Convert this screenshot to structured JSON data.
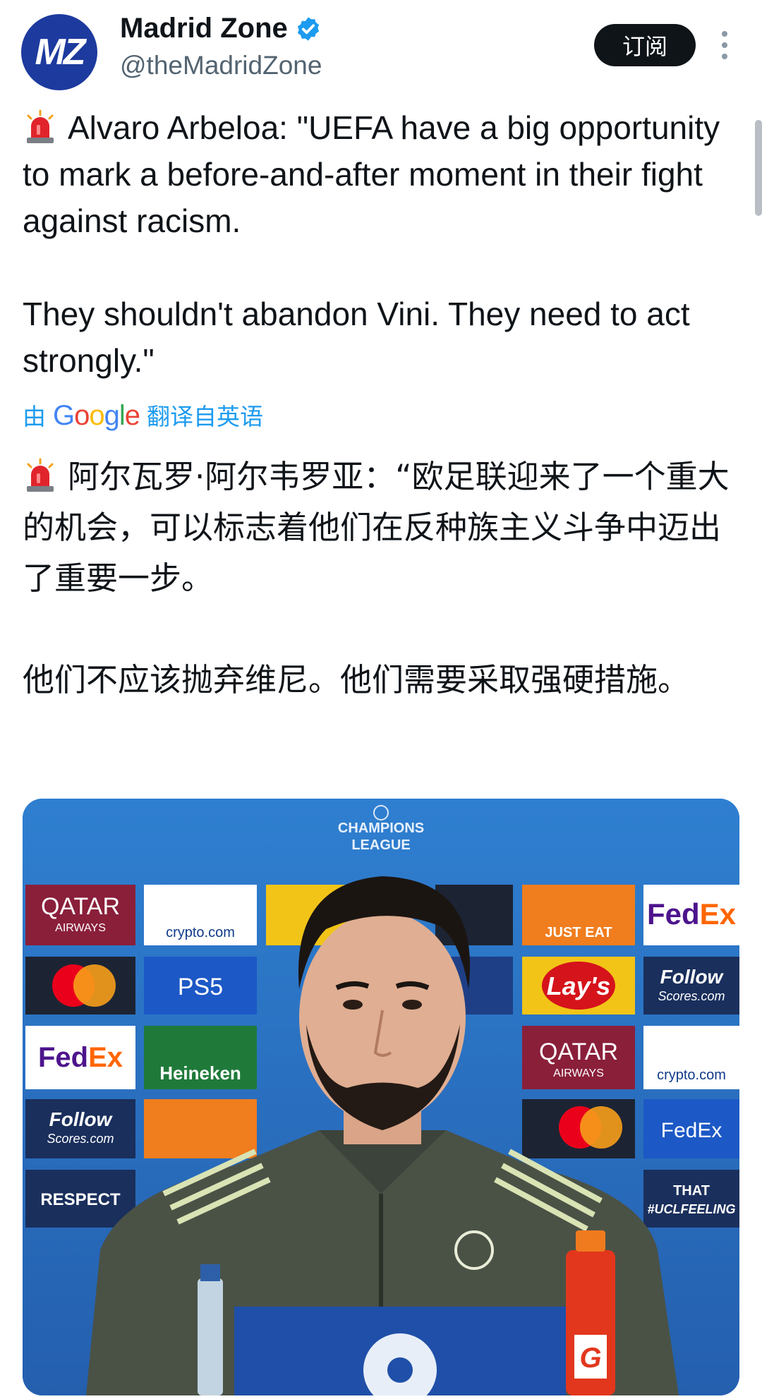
{
  "account": {
    "display_name": "Madrid Zone",
    "handle": "@theMadridZone",
    "avatar_text": "MZ",
    "verified": true
  },
  "actions": {
    "subscribe_label": "订阅"
  },
  "tweet": {
    "text_en": "Alvaro Arbeloa: \"UEFA have a big opportunity to mark a before-and-after moment in their fight against racism.\n\nThey shouldn't abandon Vini. They need to act strongly.\"",
    "translated_by_prefix": "由",
    "translated_by_brand": "Google",
    "translated_by_suffix": "翻译自英语",
    "text_zh": "阿尔瓦罗·阿尔韦罗亚：“欧足联迎来了一个重大的机会，可以标志着他们在反种族主义斗争中迈出了重要一步。\n\n他们不应该抛弃维尼。他们需要采取强硬措施。"
  },
  "media": {
    "backdrop_title_line1": "CHAMPIONS",
    "backdrop_title_line2": "LEAGUE",
    "sponsors": [
      "QATAR",
      "AIRWAYS",
      "crypto.com",
      "FedEx",
      "PS5",
      "JUST EAT",
      "Lay's",
      "Heineken",
      "Follow",
      "Scores.com",
      "RESPECT",
      "THAT",
      "#UCLFEELING"
    ]
  },
  "colors": {
    "link": "#1d9bf0",
    "verified": "#1d9bf0",
    "avatar_bg": "#1d3a9e",
    "backdrop": "#2e79c9",
    "jacket": "#4a5246"
  }
}
